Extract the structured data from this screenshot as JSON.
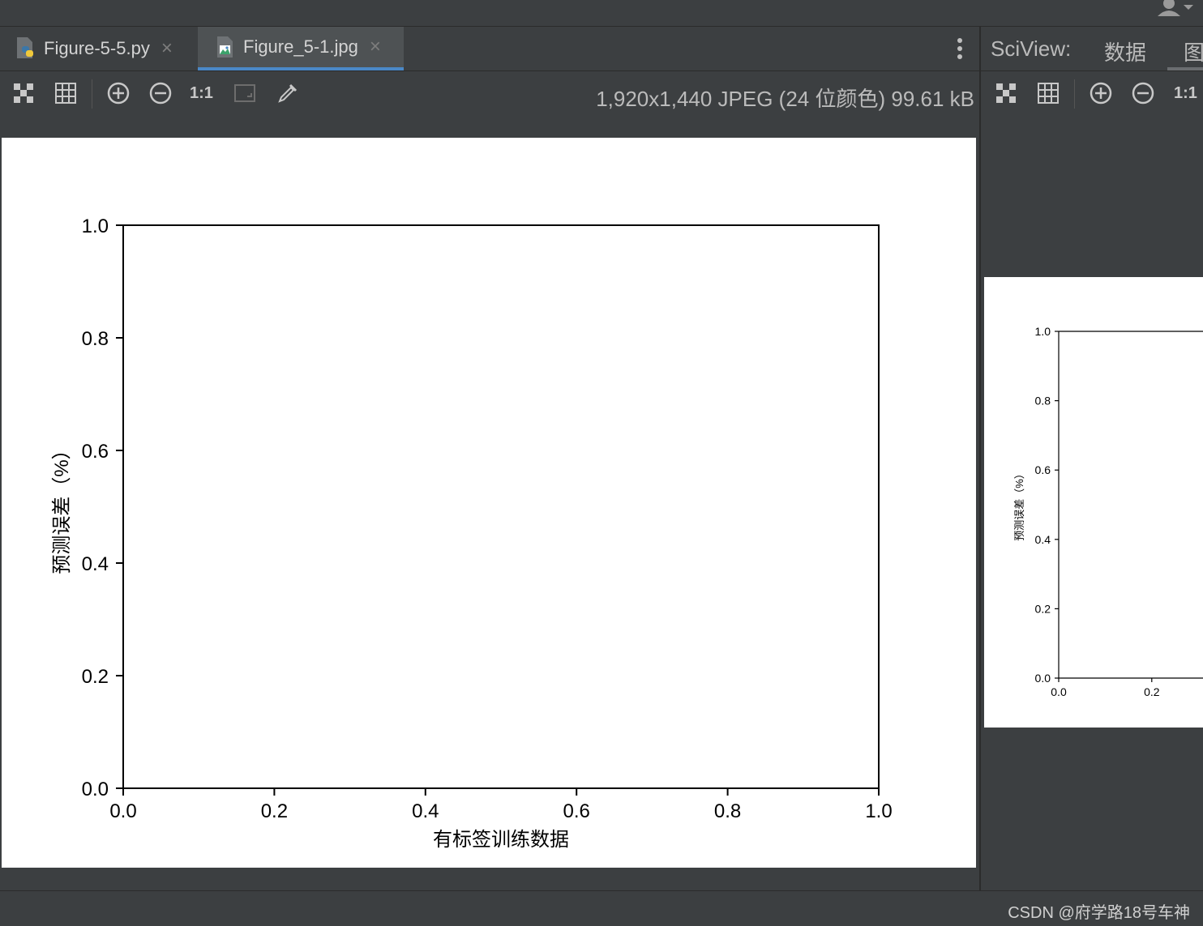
{
  "editor": {
    "tabs": [
      {
        "label": "Figure-5-5.py",
        "active": false
      },
      {
        "label": "Figure_5-1.jpg",
        "active": true
      }
    ],
    "close_glyph": "×"
  },
  "image_toolbar": {
    "actual_size_label": "1:1",
    "image_info": "1,920x1,440 JPEG (24 位颜色) 99.61 kB"
  },
  "sciview": {
    "title": "SciView:",
    "tabs": [
      "数据",
      "图"
    ],
    "actual_size_label": "1:1"
  },
  "chart_data": {
    "type": "line",
    "series": [],
    "xlabel": "有标签训练数据",
    "ylabel": "预测误差（%）",
    "xlim": [
      0.0,
      1.0
    ],
    "ylim": [
      0.0,
      1.0
    ],
    "xticks": [
      "0.0",
      "0.2",
      "0.4",
      "0.6",
      "0.8",
      "1.0"
    ],
    "yticks": [
      "0.0",
      "0.2",
      "0.4",
      "0.6",
      "0.8",
      "1.0"
    ],
    "grid": false
  },
  "thumbnail": {
    "xticks_visible": [
      "0.0",
      "0.2"
    ],
    "yticks": [
      "0.0",
      "0.2",
      "0.4",
      "0.6",
      "0.8",
      "1.0"
    ],
    "ylabel": "预测误差（%）"
  },
  "statusbar": {
    "watermark": "CSDN @府学路18号车神"
  },
  "colors": {
    "ide_background": "#3c3f41",
    "active_tab_underline": "#4a88c7",
    "image_background": "#ffffff"
  }
}
